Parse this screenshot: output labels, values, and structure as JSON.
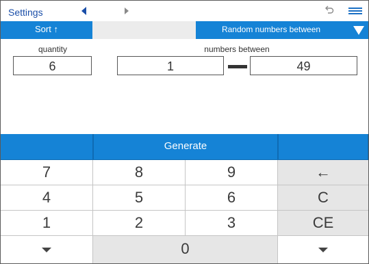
{
  "topbar": {
    "settings_label": "Settings",
    "back_icon": "triangle-left-icon",
    "forward_icon": "triangle-right-icon",
    "undo_icon": "undo-icon",
    "menu_icon": "hamburger-menu-icon"
  },
  "toolbar": {
    "sort_label": "Sort ↑",
    "mode_label": "Random numbers between",
    "mode_dropdown_icon": "triangle-down-icon"
  },
  "form": {
    "quantity_label": "quantity",
    "quantity_value": "6",
    "range_label": "numbers between",
    "range_min": "1",
    "range_max": "49"
  },
  "keypad": {
    "generate_label": "Generate",
    "keys": {
      "k7": "7",
      "k8": "8",
      "k9": "9",
      "backspace": "←",
      "k4": "4",
      "k5": "5",
      "k6": "6",
      "clear": "C",
      "k1": "1",
      "k2": "2",
      "k3": "3",
      "clear_entry": "CE",
      "k0": "0"
    }
  },
  "colors": {
    "accent": "#1583d6",
    "link": "#1a4ea8",
    "key_grey": "#e6e6e6"
  }
}
